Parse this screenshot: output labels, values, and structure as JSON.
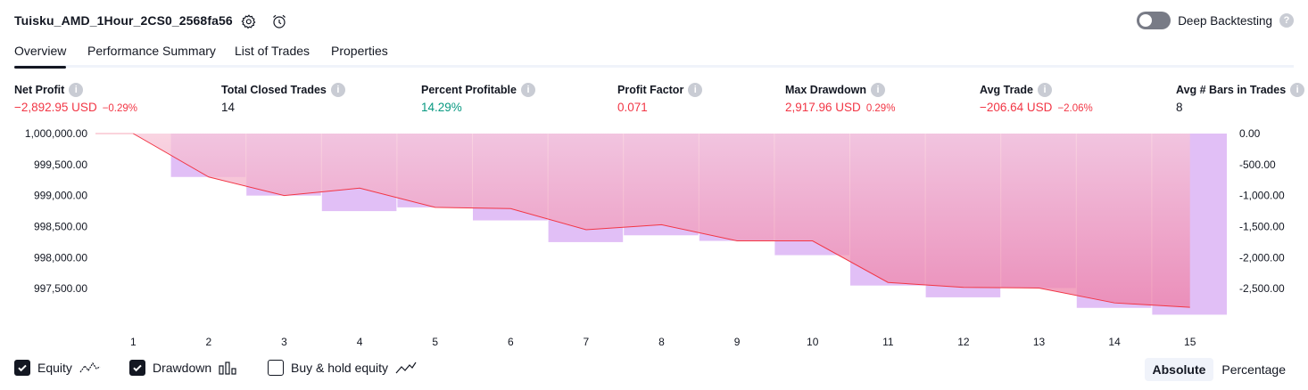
{
  "header": {
    "strategy_name": "Tuisku_AMD_1Hour_2CS0_2568fa56",
    "settings_icon": "gear-icon",
    "alert_icon": "alarm-clock-icon",
    "deep_backtesting_label": "Deep Backtesting",
    "deep_backtesting_enabled": false,
    "help_icon": "question-icon"
  },
  "tabs": [
    {
      "label": "Overview",
      "active": true
    },
    {
      "label": "Performance Summary",
      "active": false
    },
    {
      "label": "List of Trades",
      "active": false
    },
    {
      "label": "Properties",
      "active": false
    }
  ],
  "metrics": {
    "net_profit": {
      "label": "Net Profit",
      "value": "−2,892.95 USD",
      "pct": "−0.29%"
    },
    "total_closed_trades": {
      "label": "Total Closed Trades",
      "value": "14"
    },
    "percent_profitable": {
      "label": "Percent Profitable",
      "value": "14.29%"
    },
    "profit_factor": {
      "label": "Profit Factor",
      "value": "0.071"
    },
    "max_drawdown": {
      "label": "Max Drawdown",
      "value": "2,917.96 USD",
      "pct": "0.29%"
    },
    "avg_trade": {
      "label": "Avg Trade",
      "value": "−206.64 USD",
      "pct": "−2.06%"
    },
    "avg_bars": {
      "label": "Avg # Bars in Trades",
      "value": "8"
    }
  },
  "chart_data": {
    "type": "line",
    "x": [
      1,
      2,
      3,
      4,
      5,
      6,
      7,
      8,
      9,
      10,
      11,
      12,
      13,
      14,
      15
    ],
    "series": [
      {
        "name": "Equity",
        "type": "line",
        "color": "#f23645",
        "values": [
          1000000,
          999300,
          999000,
          999120,
          998810,
          998790,
          998450,
          998530,
          998270,
          998270,
          997600,
          997520,
          997510,
          997270,
          997200
        ]
      },
      {
        "name": "Drawdown",
        "type": "bar",
        "color": "#dcb4f5",
        "values": [
          null,
          -700,
          -1000,
          -1250,
          -1190,
          -1400,
          -1750,
          -1640,
          -1730,
          -1960,
          -2450,
          -2640,
          -2490,
          -2810,
          -2920
        ]
      }
    ],
    "left_axis": {
      "ticks": [
        "1,000,000.00",
        "999,500.00",
        "999,000.00",
        "998,500.00",
        "998,000.00",
        "997,500.00"
      ],
      "min": 997000,
      "max": 1000000
    },
    "right_axis": {
      "ticks": [
        "0.00",
        "-500.00",
        "-1,000.00",
        "-1,500.00",
        "-2,000.00",
        "-2,500.00"
      ],
      "min": -3000,
      "max": 0
    },
    "x_ticks": [
      "1",
      "2",
      "3",
      "4",
      "5",
      "6",
      "7",
      "8",
      "9",
      "10",
      "11",
      "12",
      "13",
      "14",
      "15"
    ]
  },
  "footer": {
    "equity": {
      "label": "Equity",
      "checked": true,
      "icon": "equity-line-icon"
    },
    "drawdown": {
      "label": "Drawdown",
      "checked": true,
      "icon": "drawdown-bars-icon"
    },
    "buy_hold": {
      "label": "Buy & hold equity",
      "checked": false,
      "icon": "buy-hold-line-icon"
    },
    "absolute_label": "Absolute",
    "percentage_label": "Percentage"
  }
}
